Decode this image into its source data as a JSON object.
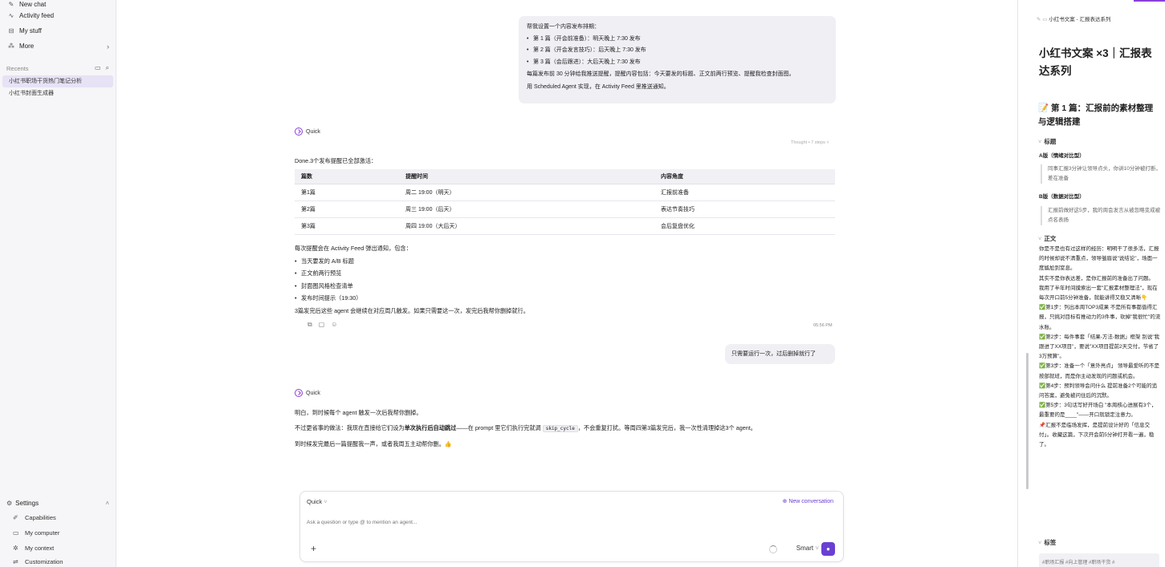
{
  "sidebar": {
    "nav": [
      {
        "label": "New chat",
        "icon": "new-chat-icon"
      },
      {
        "label": "Activity feed",
        "icon": "activity-icon"
      },
      {
        "label": "My stuff",
        "icon": "stuff-icon"
      },
      {
        "label": "More",
        "icon": "more-icon"
      }
    ],
    "recents_label": "Recents",
    "recents": [
      "小红书职场干货热门笔记分析",
      "小红书封面生成器"
    ],
    "settings_label": "Settings",
    "settings_items": [
      {
        "label": "Capabilities",
        "icon": "capabilities-icon"
      },
      {
        "label": "My computer",
        "icon": "computer-icon"
      },
      {
        "label": "My context",
        "icon": "context-icon"
      },
      {
        "label": "Customization",
        "icon": "customization-icon"
      }
    ]
  },
  "chat": {
    "user1": {
      "intro": "帮我设置一个内容发布排期：",
      "items": [
        "第 1 篇（开会前准备）：明天晚上 7:30 发布",
        "第 2 篇（开会发言技巧）：后天晚上 7:30 发布",
        "第 3 篇（会后跟进）：大后天晚上 7:30 发布"
      ],
      "line2": "每篇发布前 30 分钟给我推送提醒，提醒内容包括：今天要发的标题、正文前两行预览、提醒我检查封面图。",
      "line3": "用 Scheduled Agent 实现，在 Activity Feed 里推送通知。"
    },
    "agent_name": "Quick",
    "thought": "Thought • 7 steps",
    "agent1": {
      "done": "Done.3个发布提醒已全部激活：",
      "table_headers": [
        "篇数",
        "提醒时间",
        "内容角度"
      ],
      "table_rows": [
        [
          "第1篇",
          "周二 19:00（明天）",
          "汇报前准备"
        ],
        [
          "第2篇",
          "周三 19:00（后天）",
          "表达节奏技巧"
        ],
        [
          "第3篇",
          "周四 19:00（大后天）",
          "会后复盘优化"
        ]
      ],
      "note": "每次提醒会在 Activity Feed 弹出通知，包含：",
      "items": [
        "当天要发的 A/B 标题",
        "正文前两行预览",
        "封面图风格检查清单",
        "发布时间提示（19:30）"
      ],
      "footer": "3篇发完后这些 agent 会继续在对应周几触发。如果只需要这一次，发完后我帮你删掉就行。",
      "time": "05:56 PM"
    },
    "user2": "只需要运行一次，过后删掉就行了",
    "agent2": {
      "p1": "明白，到时候每个 agent 触发一次后我帮你删掉。",
      "p2_a": "不过更省事的做法：我现在直接给它们设为",
      "p2_bold": "单次执行后自动跳过",
      "p2_b": "——在 prompt 里它们执行完就调",
      "p2_code": "skip_cycle",
      "p2_c": "，不会重复打扰。等周四第3篇发完后，我一次性清理掉这3个 agent。",
      "p3": "到时候发完最后一篇提醒我一声，或者我周五主动帮你删。👍"
    }
  },
  "composer": {
    "agent": "Quick",
    "new_conversation": "New conversation",
    "placeholder": "Ask a question or type @ to mention an agent...",
    "mode": "Smart"
  },
  "panel": {
    "header": "小红书文案 - 汇报表达系列",
    "title": "小红书文案 ×3｜汇报表达系列",
    "h2": "📝 第 1 篇：汇报前的素材整理与逻辑搭建",
    "sec_title": "标题",
    "a_label": "A版（情绪对比型）",
    "a_text": "同事汇报3分钟让领导点头，你讲10分钟被打断，差在准备",
    "b_label": "B版（数据对比型）",
    "b_text": "汇报前做好这5步，我的周会发言从被忽略变成被点名表扬",
    "sec_body": "正文",
    "body": [
      "你是不是也有过这样的经历：明明干了很多活，汇报的时候却说不清重点，领导皱眉说\"说结论\"，场面一度尴尬到窒息。",
      "其实不是你表达差，是你汇报前的准备出了问题。",
      "我用了半年时间摸索出一套\"汇报素材整理法\"，现在每次开口前5分钟准备，就能讲得又稳又清晰👇",
      "✅第1步：列出本周TOP3成果 不是所有事都值得汇报，只挑对目标有推动力的3件事，砍掉\"我很忙\"的流水账。",
      "✅第2步：每件事套「结果-方法-数据」框架 别说\"我跟进了XX项目\"，要说\"XX项目提前2天交付，节省了3万预算\"。",
      "✅第3步：准备一个「意外亮点」 领导最爱听的不是按部就班，而是你主动发现的问题或机会。",
      "✅第4步：预判领导会问什么 提前准备2个可能的追问答案，避免被问住后的沉默。",
      "✅第5步：3句话写好开场白 \"本周核心进展有3个，最重要的是____\"——开口就锁定注意力。",
      "📌汇报不是临场发挥，是提前设计好的「信息交付」。收藏这篇，下次开会前5分钟打开看一遍，稳了。"
    ],
    "sec_tags": "标签",
    "tags": "#职场汇报 #向上管理 #职场干货 #"
  }
}
